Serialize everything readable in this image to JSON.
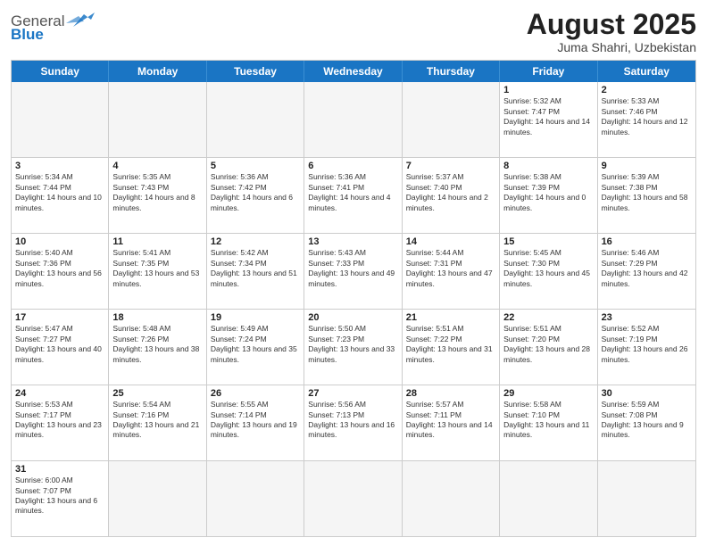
{
  "header": {
    "logo_general": "General",
    "logo_blue": "Blue",
    "month_title": "August 2025",
    "location": "Juma Shahri, Uzbekistan"
  },
  "weekdays": [
    "Sunday",
    "Monday",
    "Tuesday",
    "Wednesday",
    "Thursday",
    "Friday",
    "Saturday"
  ],
  "rows": [
    [
      {
        "day": "",
        "info": ""
      },
      {
        "day": "",
        "info": ""
      },
      {
        "day": "",
        "info": ""
      },
      {
        "day": "",
        "info": ""
      },
      {
        "day": "",
        "info": ""
      },
      {
        "day": "1",
        "info": "Sunrise: 5:32 AM\nSunset: 7:47 PM\nDaylight: 14 hours and 14 minutes."
      },
      {
        "day": "2",
        "info": "Sunrise: 5:33 AM\nSunset: 7:46 PM\nDaylight: 14 hours and 12 minutes."
      }
    ],
    [
      {
        "day": "3",
        "info": "Sunrise: 5:34 AM\nSunset: 7:44 PM\nDaylight: 14 hours and 10 minutes."
      },
      {
        "day": "4",
        "info": "Sunrise: 5:35 AM\nSunset: 7:43 PM\nDaylight: 14 hours and 8 minutes."
      },
      {
        "day": "5",
        "info": "Sunrise: 5:36 AM\nSunset: 7:42 PM\nDaylight: 14 hours and 6 minutes."
      },
      {
        "day": "6",
        "info": "Sunrise: 5:36 AM\nSunset: 7:41 PM\nDaylight: 14 hours and 4 minutes."
      },
      {
        "day": "7",
        "info": "Sunrise: 5:37 AM\nSunset: 7:40 PM\nDaylight: 14 hours and 2 minutes."
      },
      {
        "day": "8",
        "info": "Sunrise: 5:38 AM\nSunset: 7:39 PM\nDaylight: 14 hours and 0 minutes."
      },
      {
        "day": "9",
        "info": "Sunrise: 5:39 AM\nSunset: 7:38 PM\nDaylight: 13 hours and 58 minutes."
      }
    ],
    [
      {
        "day": "10",
        "info": "Sunrise: 5:40 AM\nSunset: 7:36 PM\nDaylight: 13 hours and 56 minutes."
      },
      {
        "day": "11",
        "info": "Sunrise: 5:41 AM\nSunset: 7:35 PM\nDaylight: 13 hours and 53 minutes."
      },
      {
        "day": "12",
        "info": "Sunrise: 5:42 AM\nSunset: 7:34 PM\nDaylight: 13 hours and 51 minutes."
      },
      {
        "day": "13",
        "info": "Sunrise: 5:43 AM\nSunset: 7:33 PM\nDaylight: 13 hours and 49 minutes."
      },
      {
        "day": "14",
        "info": "Sunrise: 5:44 AM\nSunset: 7:31 PM\nDaylight: 13 hours and 47 minutes."
      },
      {
        "day": "15",
        "info": "Sunrise: 5:45 AM\nSunset: 7:30 PM\nDaylight: 13 hours and 45 minutes."
      },
      {
        "day": "16",
        "info": "Sunrise: 5:46 AM\nSunset: 7:29 PM\nDaylight: 13 hours and 42 minutes."
      }
    ],
    [
      {
        "day": "17",
        "info": "Sunrise: 5:47 AM\nSunset: 7:27 PM\nDaylight: 13 hours and 40 minutes."
      },
      {
        "day": "18",
        "info": "Sunrise: 5:48 AM\nSunset: 7:26 PM\nDaylight: 13 hours and 38 minutes."
      },
      {
        "day": "19",
        "info": "Sunrise: 5:49 AM\nSunset: 7:24 PM\nDaylight: 13 hours and 35 minutes."
      },
      {
        "day": "20",
        "info": "Sunrise: 5:50 AM\nSunset: 7:23 PM\nDaylight: 13 hours and 33 minutes."
      },
      {
        "day": "21",
        "info": "Sunrise: 5:51 AM\nSunset: 7:22 PM\nDaylight: 13 hours and 31 minutes."
      },
      {
        "day": "22",
        "info": "Sunrise: 5:51 AM\nSunset: 7:20 PM\nDaylight: 13 hours and 28 minutes."
      },
      {
        "day": "23",
        "info": "Sunrise: 5:52 AM\nSunset: 7:19 PM\nDaylight: 13 hours and 26 minutes."
      }
    ],
    [
      {
        "day": "24",
        "info": "Sunrise: 5:53 AM\nSunset: 7:17 PM\nDaylight: 13 hours and 23 minutes."
      },
      {
        "day": "25",
        "info": "Sunrise: 5:54 AM\nSunset: 7:16 PM\nDaylight: 13 hours and 21 minutes."
      },
      {
        "day": "26",
        "info": "Sunrise: 5:55 AM\nSunset: 7:14 PM\nDaylight: 13 hours and 19 minutes."
      },
      {
        "day": "27",
        "info": "Sunrise: 5:56 AM\nSunset: 7:13 PM\nDaylight: 13 hours and 16 minutes."
      },
      {
        "day": "28",
        "info": "Sunrise: 5:57 AM\nSunset: 7:11 PM\nDaylight: 13 hours and 14 minutes."
      },
      {
        "day": "29",
        "info": "Sunrise: 5:58 AM\nSunset: 7:10 PM\nDaylight: 13 hours and 11 minutes."
      },
      {
        "day": "30",
        "info": "Sunrise: 5:59 AM\nSunset: 7:08 PM\nDaylight: 13 hours and 9 minutes."
      }
    ],
    [
      {
        "day": "31",
        "info": "Sunrise: 6:00 AM\nSunset: 7:07 PM\nDaylight: 13 hours and 6 minutes."
      },
      {
        "day": "",
        "info": ""
      },
      {
        "day": "",
        "info": ""
      },
      {
        "day": "",
        "info": ""
      },
      {
        "day": "",
        "info": ""
      },
      {
        "day": "",
        "info": ""
      },
      {
        "day": "",
        "info": ""
      }
    ]
  ]
}
